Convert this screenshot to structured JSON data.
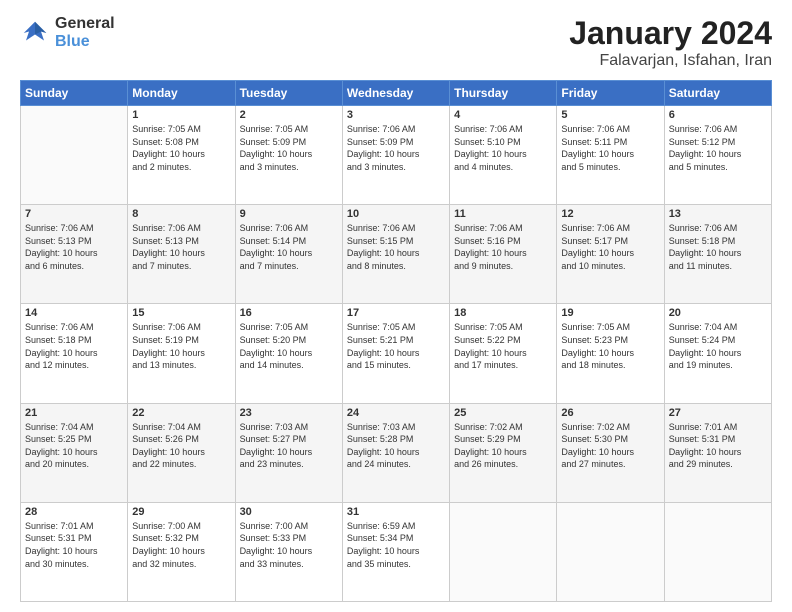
{
  "header": {
    "logo_general": "General",
    "logo_blue": "Blue",
    "title": "January 2024",
    "subtitle": "Falavarjan, Isfahan, Iran"
  },
  "days_of_week": [
    "Sunday",
    "Monday",
    "Tuesday",
    "Wednesday",
    "Thursday",
    "Friday",
    "Saturday"
  ],
  "weeks": [
    [
      {
        "day": "",
        "info": ""
      },
      {
        "day": "1",
        "info": "Sunrise: 7:05 AM\nSunset: 5:08 PM\nDaylight: 10 hours\nand 2 minutes."
      },
      {
        "day": "2",
        "info": "Sunrise: 7:05 AM\nSunset: 5:09 PM\nDaylight: 10 hours\nand 3 minutes."
      },
      {
        "day": "3",
        "info": "Sunrise: 7:06 AM\nSunset: 5:09 PM\nDaylight: 10 hours\nand 3 minutes."
      },
      {
        "day": "4",
        "info": "Sunrise: 7:06 AM\nSunset: 5:10 PM\nDaylight: 10 hours\nand 4 minutes."
      },
      {
        "day": "5",
        "info": "Sunrise: 7:06 AM\nSunset: 5:11 PM\nDaylight: 10 hours\nand 5 minutes."
      },
      {
        "day": "6",
        "info": "Sunrise: 7:06 AM\nSunset: 5:12 PM\nDaylight: 10 hours\nand 5 minutes."
      }
    ],
    [
      {
        "day": "7",
        "info": "Sunrise: 7:06 AM\nSunset: 5:13 PM\nDaylight: 10 hours\nand 6 minutes."
      },
      {
        "day": "8",
        "info": "Sunrise: 7:06 AM\nSunset: 5:13 PM\nDaylight: 10 hours\nand 7 minutes."
      },
      {
        "day": "9",
        "info": "Sunrise: 7:06 AM\nSunset: 5:14 PM\nDaylight: 10 hours\nand 7 minutes."
      },
      {
        "day": "10",
        "info": "Sunrise: 7:06 AM\nSunset: 5:15 PM\nDaylight: 10 hours\nand 8 minutes."
      },
      {
        "day": "11",
        "info": "Sunrise: 7:06 AM\nSunset: 5:16 PM\nDaylight: 10 hours\nand 9 minutes."
      },
      {
        "day": "12",
        "info": "Sunrise: 7:06 AM\nSunset: 5:17 PM\nDaylight: 10 hours\nand 10 minutes."
      },
      {
        "day": "13",
        "info": "Sunrise: 7:06 AM\nSunset: 5:18 PM\nDaylight: 10 hours\nand 11 minutes."
      }
    ],
    [
      {
        "day": "14",
        "info": "Sunrise: 7:06 AM\nSunset: 5:18 PM\nDaylight: 10 hours\nand 12 minutes."
      },
      {
        "day": "15",
        "info": "Sunrise: 7:06 AM\nSunset: 5:19 PM\nDaylight: 10 hours\nand 13 minutes."
      },
      {
        "day": "16",
        "info": "Sunrise: 7:05 AM\nSunset: 5:20 PM\nDaylight: 10 hours\nand 14 minutes."
      },
      {
        "day": "17",
        "info": "Sunrise: 7:05 AM\nSunset: 5:21 PM\nDaylight: 10 hours\nand 15 minutes."
      },
      {
        "day": "18",
        "info": "Sunrise: 7:05 AM\nSunset: 5:22 PM\nDaylight: 10 hours\nand 17 minutes."
      },
      {
        "day": "19",
        "info": "Sunrise: 7:05 AM\nSunset: 5:23 PM\nDaylight: 10 hours\nand 18 minutes."
      },
      {
        "day": "20",
        "info": "Sunrise: 7:04 AM\nSunset: 5:24 PM\nDaylight: 10 hours\nand 19 minutes."
      }
    ],
    [
      {
        "day": "21",
        "info": "Sunrise: 7:04 AM\nSunset: 5:25 PM\nDaylight: 10 hours\nand 20 minutes."
      },
      {
        "day": "22",
        "info": "Sunrise: 7:04 AM\nSunset: 5:26 PM\nDaylight: 10 hours\nand 22 minutes."
      },
      {
        "day": "23",
        "info": "Sunrise: 7:03 AM\nSunset: 5:27 PM\nDaylight: 10 hours\nand 23 minutes."
      },
      {
        "day": "24",
        "info": "Sunrise: 7:03 AM\nSunset: 5:28 PM\nDaylight: 10 hours\nand 24 minutes."
      },
      {
        "day": "25",
        "info": "Sunrise: 7:02 AM\nSunset: 5:29 PM\nDaylight: 10 hours\nand 26 minutes."
      },
      {
        "day": "26",
        "info": "Sunrise: 7:02 AM\nSunset: 5:30 PM\nDaylight: 10 hours\nand 27 minutes."
      },
      {
        "day": "27",
        "info": "Sunrise: 7:01 AM\nSunset: 5:31 PM\nDaylight: 10 hours\nand 29 minutes."
      }
    ],
    [
      {
        "day": "28",
        "info": "Sunrise: 7:01 AM\nSunset: 5:31 PM\nDaylight: 10 hours\nand 30 minutes."
      },
      {
        "day": "29",
        "info": "Sunrise: 7:00 AM\nSunset: 5:32 PM\nDaylight: 10 hours\nand 32 minutes."
      },
      {
        "day": "30",
        "info": "Sunrise: 7:00 AM\nSunset: 5:33 PM\nDaylight: 10 hours\nand 33 minutes."
      },
      {
        "day": "31",
        "info": "Sunrise: 6:59 AM\nSunset: 5:34 PM\nDaylight: 10 hours\nand 35 minutes."
      },
      {
        "day": "",
        "info": ""
      },
      {
        "day": "",
        "info": ""
      },
      {
        "day": "",
        "info": ""
      }
    ]
  ]
}
